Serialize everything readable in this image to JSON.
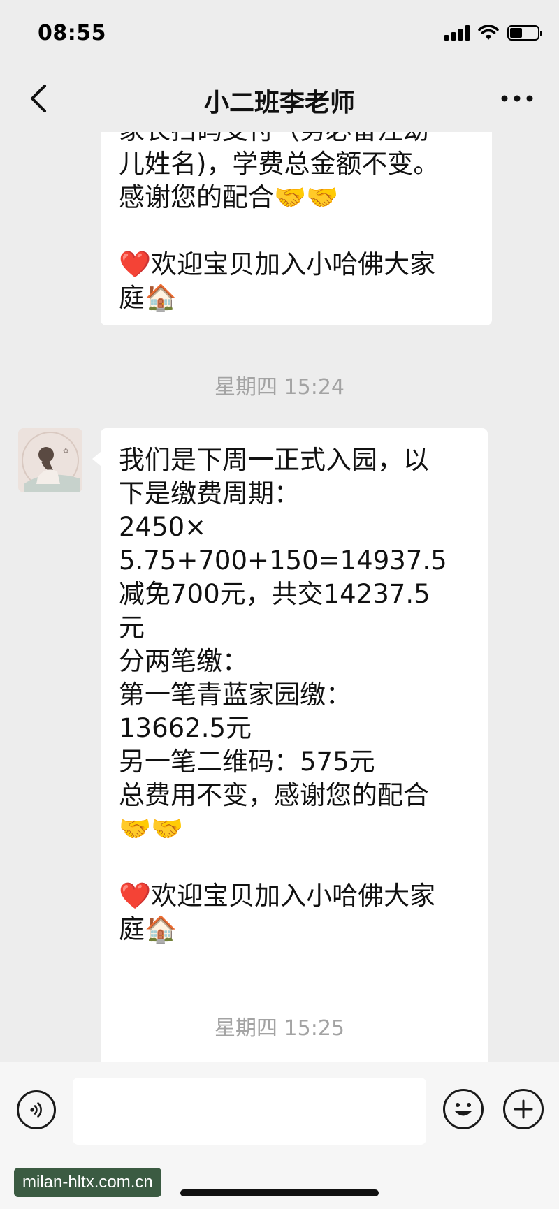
{
  "status_bar": {
    "time": "08:55",
    "battery_level": 0.45
  },
  "header": {
    "title": "小二班李老师"
  },
  "messages": [
    {
      "lines": [
        "家长扫码支付（务必备注幼",
        "儿姓名)，学费总金额不变。",
        " 感谢您的配合🤝🤝",
        "",
        "❤️欢迎宝贝加入小哈佛大家",
        "庭🏠"
      ]
    },
    {
      "timestamp": "星期四 15:24",
      "avatar": "teacher-avatar",
      "lines": [
        "我们是下周一正式入园，以",
        "下是缴费周期：",
        "2450×",
        "5.75+700+150=14937.5",
        "减免700元，共交14237.5",
        "元",
        "分两笔缴：",
        "第一笔青蓝家园缴：",
        "13662.5元",
        "另一笔二维码：575元",
        "总费用不变，感谢您的配合",
        "🤝🤝",
        "",
        "❤️欢迎宝贝加入小哈佛大家",
        "庭🏠"
      ]
    }
  ],
  "trailing_timestamp": "星期四 15:25",
  "input_bar": {
    "placeholder": "",
    "value": ""
  },
  "watermark": "milan-hltx.com.cn",
  "icons": {
    "back": "chevron-left-icon",
    "more": "more-dots-icon",
    "voice": "voice-icon",
    "emoji": "emoji-icon",
    "plus": "plus-icon"
  }
}
